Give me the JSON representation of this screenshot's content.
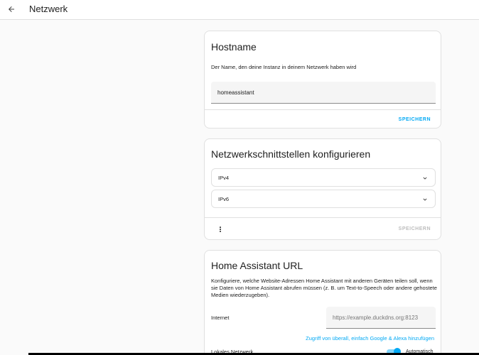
{
  "header": {
    "title": "Netzwerk",
    "back_icon": "arrow-left-icon"
  },
  "hostname_card": {
    "title": "Hostname",
    "description": "Der Name, den deine Instanz in deinem Netzwerk haben wird",
    "value": "homeassistant",
    "save_label": "SPEICHERN"
  },
  "interfaces_card": {
    "title": "Netzwerkschnittstellen konfigurieren",
    "items": [
      {
        "label": "IPv4"
      },
      {
        "label": "IPv6"
      }
    ],
    "save_label": "SPEICHERN"
  },
  "url_card": {
    "title": "Home Assistant URL",
    "description": "Konfiguriere, welche Website-Adressen Home Assistant mit anderen Geräten teilen soll, wenn sie Daten von Home Assistant abrufen müssen (z. B. um Text-to-Speech oder andere gehostete Medien wiederzugeben).",
    "internet_label": "Internet",
    "internet_placeholder": "https://example.duckdns.org:8123",
    "link_text": "Zugriff von überall, einfach Google & Alexa hinzufügen",
    "local_label": "Lokales Netzwerk",
    "auto_label": "Automatisch",
    "auto_enabled": true
  },
  "colors": {
    "accent": "#03a9f4",
    "divider": "#e0e0e0",
    "background": "#fafafa"
  }
}
